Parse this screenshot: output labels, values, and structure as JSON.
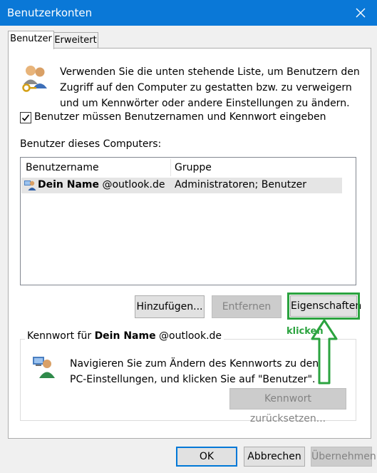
{
  "window": {
    "title": "Benutzerkonten"
  },
  "tabs": [
    {
      "label": "Benutzer",
      "active": true
    },
    {
      "label": "Erweitert",
      "active": false
    }
  ],
  "intro": {
    "text": "Verwenden Sie die unten stehende Liste, um Benutzern den Zugriff auf den Computer zu gestatten bzw. zu verweigern und um Kennwörter oder andere Einstellungen zu ändern."
  },
  "checkbox": {
    "label": "Benutzer müssen Benutzernamen und Kennwort eingeben",
    "checked": true
  },
  "users_section": {
    "label": "Benutzer dieses Computers:",
    "columns": [
      "Benutzername",
      "Gruppe"
    ],
    "rows": [
      {
        "name_bold": "Dein Name",
        "name_rest": "@outlook.de",
        "group": "Administratoren; Benutzer"
      }
    ]
  },
  "buttons": {
    "add": "Hinzufügen...",
    "remove": "Entfernen",
    "properties": "Eigenschaften",
    "reset_password": "Kennwort zurücksetzen...",
    "ok": "OK",
    "cancel": "Abbrechen",
    "apply": "Übernehmen"
  },
  "password_group": {
    "legend_prefix": "Kennwort für ",
    "legend_bold": "Dein Name",
    "legend_rest": " @outlook.de",
    "text": "Navigieren Sie zum Ändern des Kennworts zu den PC-Einstellungen, und klicken Sie auf \"Benutzer\"."
  },
  "annotation": {
    "text": "klicken",
    "color": "#2ba33f"
  },
  "colors": {
    "titlebar": "#0a78d7",
    "highlight": "#2ba33f",
    "focus": "#0078d7"
  },
  "icons": [
    "close-icon",
    "users-key-icon",
    "user-list-icon",
    "user-security-icon",
    "up-arrow-icon",
    "checkmark-icon"
  ]
}
